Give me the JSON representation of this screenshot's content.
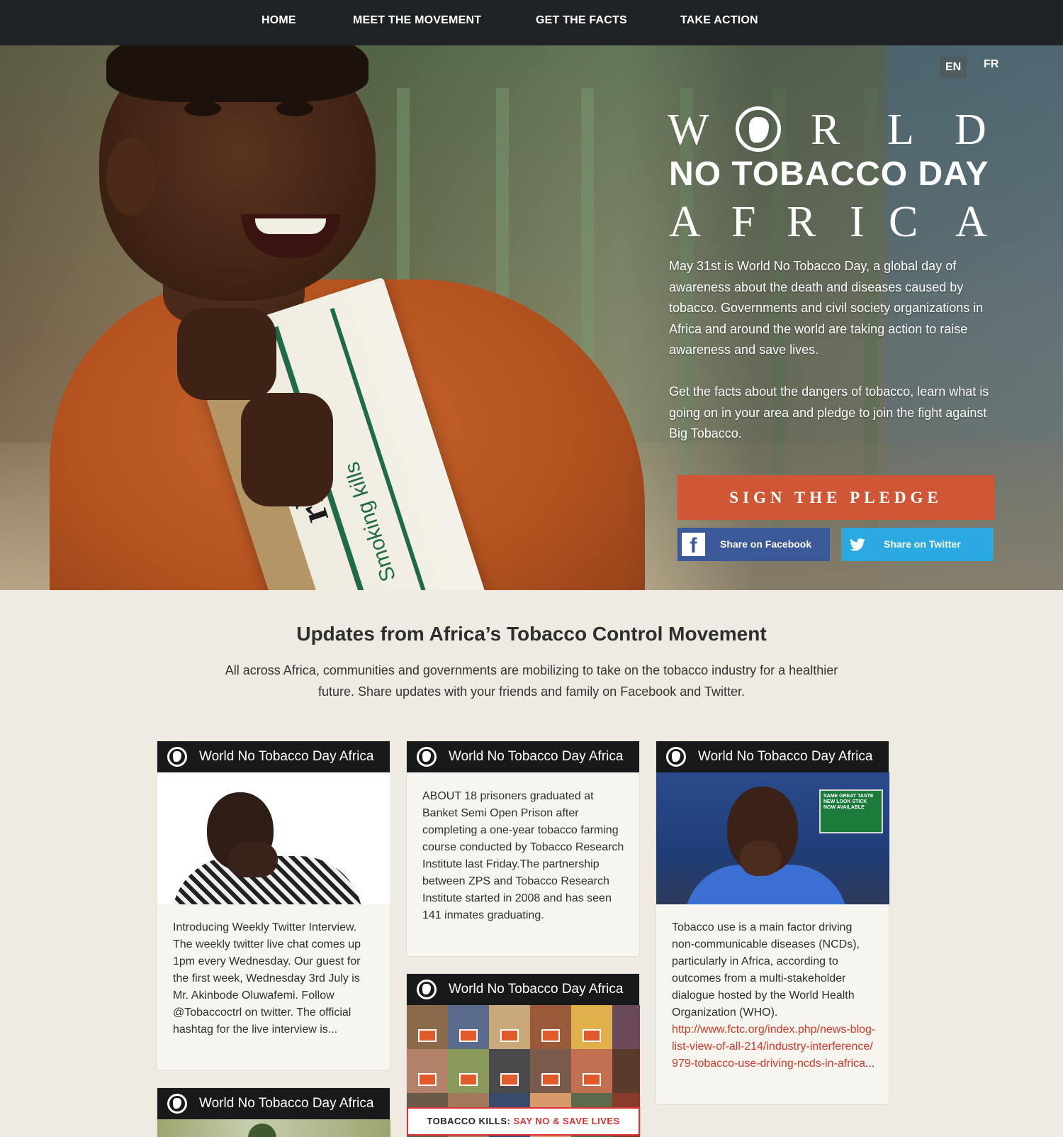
{
  "nav": {
    "items": [
      {
        "label": "HOME"
      },
      {
        "label": "MEET THE MOVEMENT"
      },
      {
        "label": "GET THE FACTS"
      },
      {
        "label": "TAKE ACTION"
      }
    ]
  },
  "languages": {
    "en": "EN",
    "fr": "FR",
    "active": "EN"
  },
  "hero": {
    "logo": {
      "line1": [
        "W",
        "R",
        "L",
        "D"
      ],
      "line2": "NO TOBACCO DAY",
      "line3": [
        "A",
        "F",
        "R",
        "I",
        "C",
        "A"
      ]
    },
    "photo_pack": {
      "brand": "rlboro",
      "warning": "Smoking kills"
    },
    "paragraph1": "May 31st is World No Tobacco Day, a global day of awareness about the death and diseases caused by tobacco. Governments and civil society organizations in Africa and around the world are taking action to raise awareness and save lives.",
    "paragraph2": "Get the facts about the dangers of tobacco, learn what is going on in your area and pledge to join the fight against Big Tobacco.",
    "pledge_label": "SIGN THE PLEDGE",
    "share_facebook": "Share on Facebook",
    "share_twitter": "Share on Twitter"
  },
  "updates": {
    "title": "Updates from Africa’s Tobacco Control Movement",
    "description": "All across Africa, communities and governments are mobilizing to take on the tobacco industry for a healthier future. Share updates with your friends and family on Facebook and Twitter.",
    "cards": [
      {
        "header": "World No Tobacco Day Africa",
        "text": "Introducing Weekly Twitter Interview. The weekly twitter live chat comes up 1pm every Wednesday. Our guest for the first week, Wednesday 3rd July is Mr. Akinbode Oluwafemi. Follow @Tobaccoctrl on twitter. The official hashtag for the live interview is..."
      },
      {
        "header": "World No Tobacco Day Africa",
        "text": "ABOUT 18 prisoners graduated at Banket Semi Open Prison after completing a one-year tobacco farming course conducted by Tobacco Research Institute last Friday.The partnership between ZPS and Tobacco Research Institute started in 2008 and has seen 141 inmates graduating."
      },
      {
        "header": "World No Tobacco Day Africa",
        "text": "Tobacco use is a main factor driving non-communicable diseases (NCDs), particularly in Africa, according to outcomes from a multi-stakeholder dialogue hosted by the World Health Organization (WHO).",
        "link": "http://www.fctc.org/index.php/news-blog-list-view-of-all-214/industry-interference/979-tobacco-use-driving-ncds-in-africa",
        "ellipsis": "...",
        "image_sign": "SAME GREAT TASTE NEW LOOK STICK NOW AVAILABLE"
      },
      {
        "header": "World No Tobacco Day Africa",
        "banner_prefix": "TOBACCO KILLS:",
        "banner_red": "SAY NO & SAVE LIVES"
      },
      {
        "header": "World No Tobacco Day Africa"
      }
    ]
  },
  "colors": {
    "nav_bg": "#1f2224",
    "pledge": "#cf5735",
    "facebook": "#3b5898",
    "twitter": "#2ba9e1",
    "page_bg": "#efebe2",
    "card_header": "#17191a",
    "link": "#cf3b2a"
  }
}
